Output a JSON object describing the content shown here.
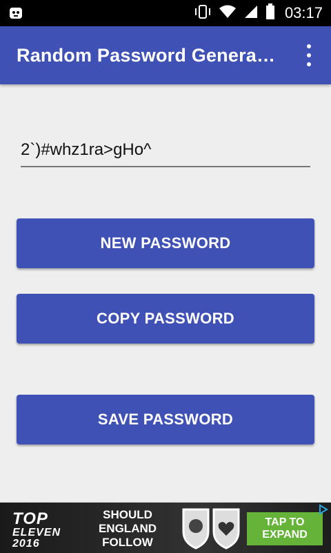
{
  "status_bar": {
    "time": "03:17",
    "icons": [
      "app-notification-icon",
      "vibrate-icon",
      "wifi-icon",
      "cell-signal-icon",
      "battery-icon"
    ]
  },
  "app_bar": {
    "title": "Random Password Genera…",
    "menu_icon": "overflow-menu-icon",
    "color": "#3f51b5"
  },
  "password": {
    "value": "2`)#whz1ra>gHo^"
  },
  "buttons": {
    "new_label": "NEW PASSWORD",
    "copy_label": "COPY PASSWORD",
    "save_label": "SAVE PASSWORD"
  },
  "ad": {
    "brand_line1": "TOP",
    "brand_line2": "ELEVEN 2016",
    "headline": "SHOULD ENGLAND FOLLOW",
    "cta_line1": "TAP TO",
    "cta_line2": "EXPAND",
    "cta_color": "#66b33a"
  }
}
